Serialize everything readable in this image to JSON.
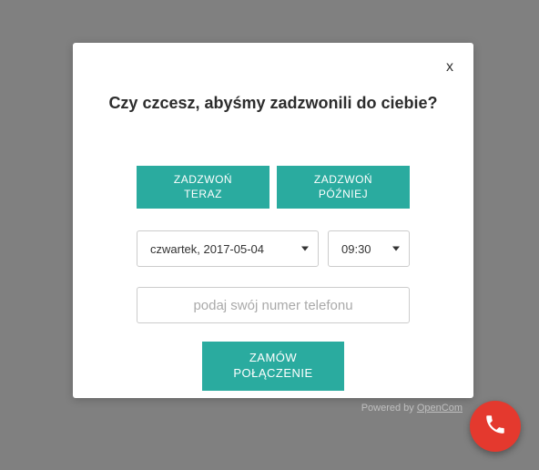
{
  "modal": {
    "close_label": "x",
    "title": "Czy czcesz, abyśmy zadzwonili do ciebie?",
    "tabs": {
      "now": "ZADZWOŃ\nTERAZ",
      "later": "ZADZWOŃ\nPÓŹNIEJ"
    },
    "date_select": "czwartek, 2017-05-04",
    "time_select": "09:30",
    "phone_placeholder": "podaj swój numer telefonu",
    "submit": "ZAMÓW\nPOŁĄCZENIE"
  },
  "footer": {
    "prefix": "Powered by ",
    "brand": "OpenCom"
  }
}
